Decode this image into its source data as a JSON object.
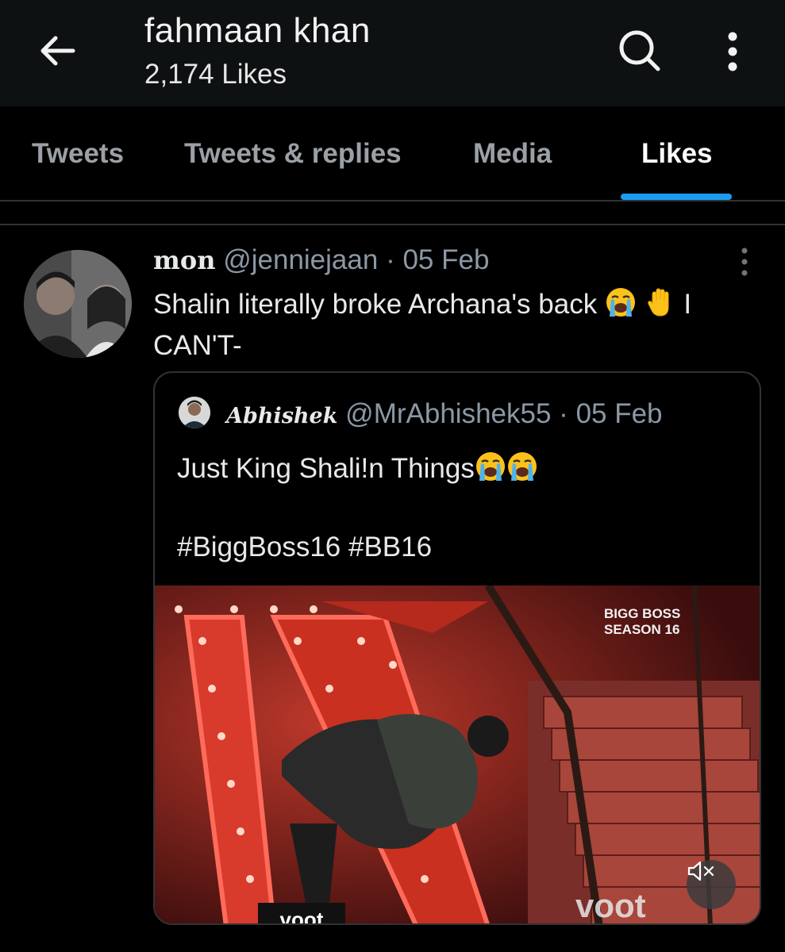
{
  "header": {
    "title": "fahmaan khan",
    "subtitle": "2,174 Likes",
    "back_icon": "arrow-left-icon",
    "search_icon": "search-icon",
    "more_icon": "more-vertical-icon"
  },
  "tabs": [
    {
      "label": "Tweets",
      "active": false
    },
    {
      "label": "Tweets & replies",
      "active": false
    },
    {
      "label": "Media",
      "active": false
    },
    {
      "label": "Likes",
      "active": true
    }
  ],
  "tweet": {
    "name": "mon",
    "handle": "@jenniejaan",
    "separator": "·",
    "date": "05 Feb",
    "text_part1": "Shalin literally broke Archana's back",
    "text_part2": "I CAN'T-",
    "emojis": [
      "loudly-crying-face",
      "raised-hand"
    ],
    "quote": {
      "name": "Abhishek",
      "handle": "@MrAbhishek55",
      "separator": "·",
      "date": "05 Feb",
      "text": "Just King Shali!n Things",
      "hashtags": "#BiggBoss16 #BB16",
      "media": {
        "watermark_line1": "BIGG BOSS",
        "watermark_line2": "SEASON 16",
        "brand_right": "voot",
        "brand_left": "voot",
        "mute_icon": "volume-muted-icon"
      }
    }
  },
  "colors": {
    "accent": "#1d9bf0",
    "header_bg": "#0d1111",
    "muted_text": "#8b98a5"
  }
}
